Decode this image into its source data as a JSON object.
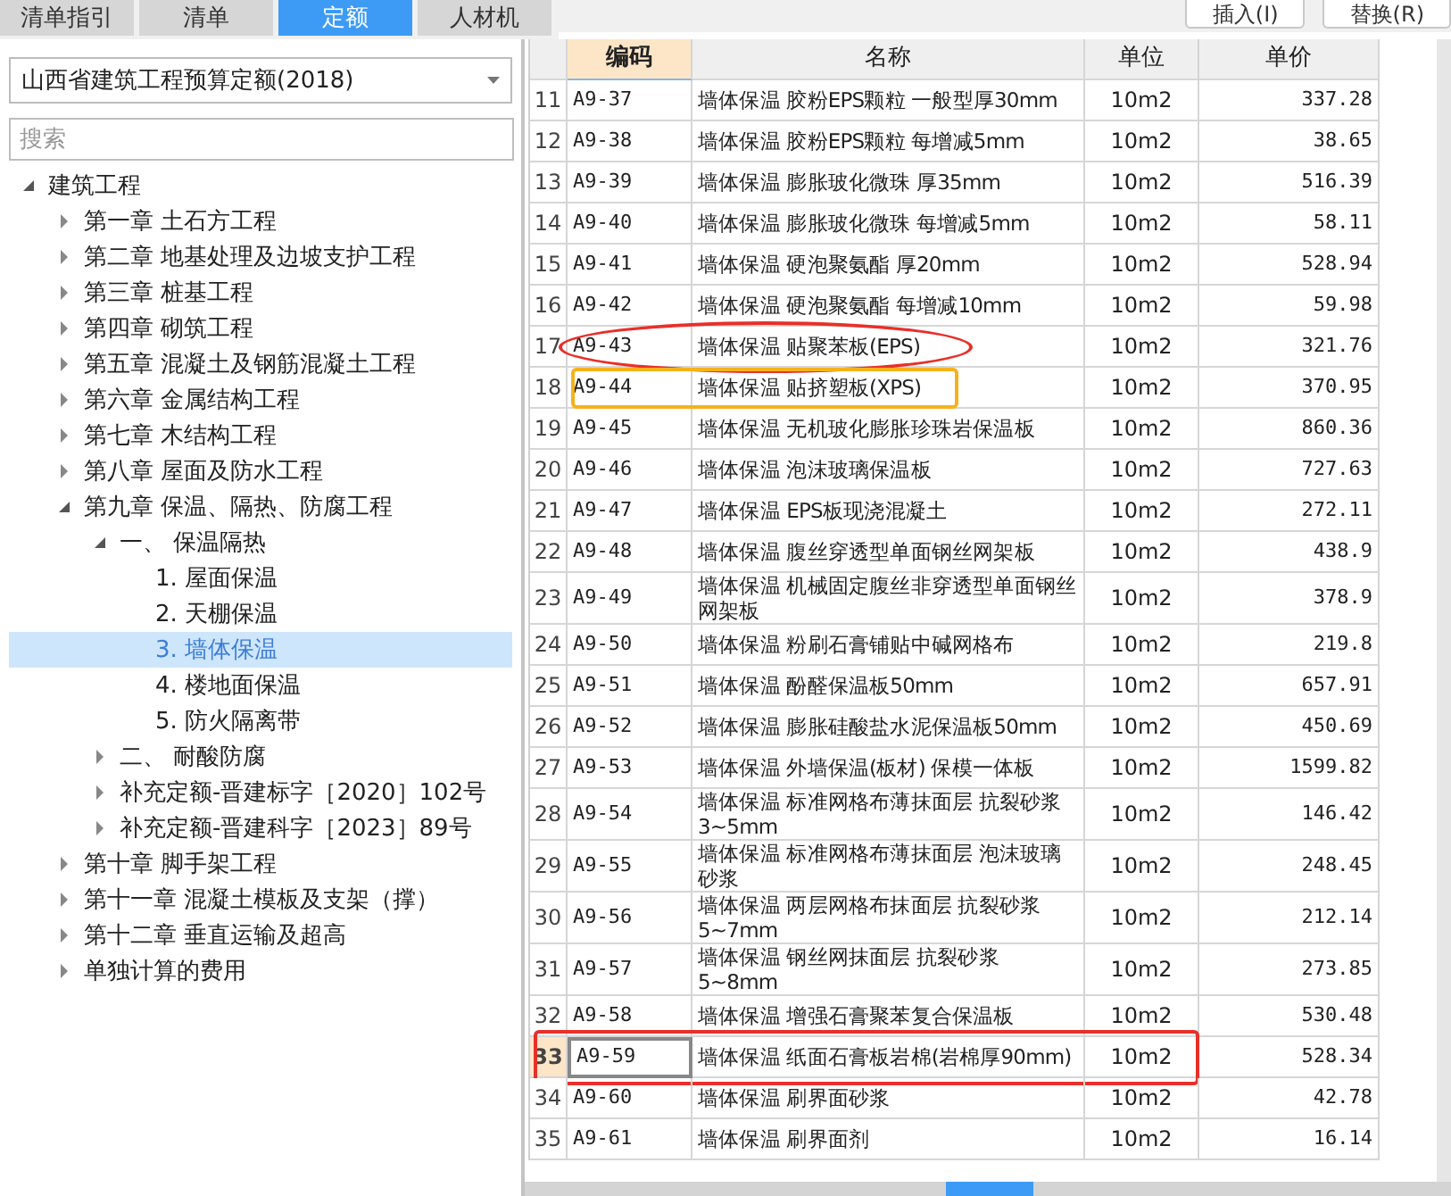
{
  "tabs": [
    {
      "label": "清单指引",
      "selected": false
    },
    {
      "label": "清单",
      "selected": false
    },
    {
      "label": "定额",
      "selected": true
    },
    {
      "label": "人材机",
      "selected": false
    }
  ],
  "toolbar": {
    "buttons": [
      "插入(I)",
      "替换(R)"
    ]
  },
  "library_select": {
    "value": "山西省建筑工程预算定额(2018)"
  },
  "search": {
    "placeholder": "搜索"
  },
  "tree": [
    {
      "label": "建筑工程",
      "expanded": true,
      "selected": false,
      "children": [
        {
          "label": "第一章 土石方工程",
          "expanded": false,
          "selected": false
        },
        {
          "label": "第二章 地基处理及边坡支护工程",
          "expanded": false,
          "selected": false
        },
        {
          "label": "第三章 桩基工程",
          "expanded": false,
          "selected": false
        },
        {
          "label": "第四章 砌筑工程",
          "expanded": false,
          "selected": false
        },
        {
          "label": "第五章 混凝土及钢筋混凝土工程",
          "expanded": false,
          "selected": false
        },
        {
          "label": "第六章 金属结构工程",
          "expanded": false,
          "selected": false
        },
        {
          "label": "第七章 木结构工程",
          "expanded": false,
          "selected": false
        },
        {
          "label": "第八章 屋面及防水工程",
          "expanded": false,
          "selected": false
        },
        {
          "label": "第九章 保温、隔热、防腐工程",
          "expanded": true,
          "selected": false,
          "children": [
            {
              "label": "一、 保温隔热",
              "expanded": true,
              "selected": false,
              "children": [
                {
                  "label": "1. 屋面保温",
                  "selected": false
                },
                {
                  "label": "2. 天棚保温",
                  "selected": false
                },
                {
                  "label": "3. 墙体保温",
                  "selected": true
                },
                {
                  "label": "4. 楼地面保温",
                  "selected": false
                },
                {
                  "label": "5. 防火隔离带",
                  "selected": false
                }
              ]
            },
            {
              "label": "二、 耐酸防腐",
              "expanded": false,
              "selected": false
            },
            {
              "label": "补充定额-晋建标字［2020］102号",
              "expanded": false,
              "selected": false
            },
            {
              "label": "补充定额-晋建科字［2023］89号",
              "expanded": false,
              "selected": false
            }
          ]
        },
        {
          "label": "第十章 脚手架工程",
          "expanded": false,
          "selected": false
        },
        {
          "label": "第十一章 混凝土模板及支架（撑）",
          "expanded": false,
          "selected": false
        },
        {
          "label": "第十二章 垂直运输及超高",
          "expanded": false,
          "selected": false
        },
        {
          "label": "单独计算的费用",
          "expanded": false,
          "selected": false
        }
      ]
    }
  ],
  "table": {
    "columns": [
      "编码",
      "名称",
      "单位",
      "单价"
    ],
    "rows": [
      {
        "no": "11",
        "code": "A9-37",
        "name": "墙体保温 胶粉EPS颗粒 一般型厚30mm",
        "unit": "10m2",
        "price": "337.28",
        "selected": false
      },
      {
        "no": "12",
        "code": "A9-38",
        "name": "墙体保温 胶粉EPS颗粒 每增减5mm",
        "unit": "10m2",
        "price": "38.65",
        "selected": false
      },
      {
        "no": "13",
        "code": "A9-39",
        "name": "墙体保温 膨胀玻化微珠 厚35mm",
        "unit": "10m2",
        "price": "516.39",
        "selected": false
      },
      {
        "no": "14",
        "code": "A9-40",
        "name": "墙体保温 膨胀玻化微珠 每增减5mm",
        "unit": "10m2",
        "price": "58.11",
        "selected": false
      },
      {
        "no": "15",
        "code": "A9-41",
        "name": "墙体保温 硬泡聚氨酯 厚20mm",
        "unit": "10m2",
        "price": "528.94",
        "selected": false
      },
      {
        "no": "16",
        "code": "A9-42",
        "name": "墙体保温 硬泡聚氨酯 每增减10mm",
        "unit": "10m2",
        "price": "59.98",
        "selected": false
      },
      {
        "no": "17",
        "code": "A9-43",
        "name": "墙体保温 贴聚苯板(EPS)",
        "unit": "10m2",
        "price": "321.76",
        "selected": false,
        "annotation": {
          "kind": "ellipse",
          "color": "#e8302a"
        }
      },
      {
        "no": "18",
        "code": "A9-44",
        "name": "墙体保温 贴挤塑板(XPS)",
        "unit": "10m2",
        "price": "370.95",
        "selected": false,
        "annotation": {
          "kind": "cellbox",
          "color": "#f5b21b"
        }
      },
      {
        "no": "19",
        "code": "A9-45",
        "name": "墙体保温 无机玻化膨胀珍珠岩保温板",
        "unit": "10m2",
        "price": "860.36",
        "selected": false
      },
      {
        "no": "20",
        "code": "A9-46",
        "name": "墙体保温 泡沫玻璃保温板",
        "unit": "10m2",
        "price": "727.63",
        "selected": false
      },
      {
        "no": "21",
        "code": "A9-47",
        "name": "墙体保温 EPS板现浇混凝土",
        "unit": "10m2",
        "price": "272.11",
        "selected": false
      },
      {
        "no": "22",
        "code": "A9-48",
        "name": "墙体保温 腹丝穿透型单面钢丝网架板",
        "unit": "10m2",
        "price": "438.9",
        "selected": false
      },
      {
        "no": "23",
        "code": "A9-49",
        "name": "墙体保温 机械固定腹丝非穿透型单面钢丝网架板",
        "unit": "10m2",
        "price": "378.9",
        "selected": false
      },
      {
        "no": "24",
        "code": "A9-50",
        "name": "墙体保温 粉刷石膏铺贴中碱网格布",
        "unit": "10m2",
        "price": "219.8",
        "selected": false
      },
      {
        "no": "25",
        "code": "A9-51",
        "name": "墙体保温 酚醛保温板50mm",
        "unit": "10m2",
        "price": "657.91",
        "selected": false
      },
      {
        "no": "26",
        "code": "A9-52",
        "name": "墙体保温 膨胀硅酸盐水泥保温板50mm",
        "unit": "10m2",
        "price": "450.69",
        "selected": false
      },
      {
        "no": "27",
        "code": "A9-53",
        "name": "墙体保温 外墙保温(板材) 保模一体板",
        "unit": "10m2",
        "price": "1599.82",
        "selected": false
      },
      {
        "no": "28",
        "code": "A9-54",
        "name": "墙体保温 标准网格布薄抹面层 抗裂砂浆3~5mm",
        "unit": "10m2",
        "price": "146.42",
        "selected": false
      },
      {
        "no": "29",
        "code": "A9-55",
        "name": "墙体保温 标准网格布薄抹面层 泡沫玻璃砂浆",
        "unit": "10m2",
        "price": "248.45",
        "selected": false
      },
      {
        "no": "30",
        "code": "A9-56",
        "name": "墙体保温 两层网格布抹面层 抗裂砂浆5~7mm",
        "unit": "10m2",
        "price": "212.14",
        "selected": false
      },
      {
        "no": "31",
        "code": "A9-57",
        "name": "墙体保温 钢丝网抹面层 抗裂砂浆5~8mm",
        "unit": "10m2",
        "price": "273.85",
        "selected": false
      },
      {
        "no": "32",
        "code": "A9-58",
        "name": "墙体保温 增强石膏聚苯复合保温板",
        "unit": "10m2",
        "price": "530.48",
        "selected": false
      },
      {
        "no": "33",
        "code": "A9-59",
        "name": "墙体保温 纸面石膏板岩棉(岩棉厚90mm)",
        "unit": "10m2",
        "price": "528.34",
        "selected": true,
        "annotation": {
          "kind": "rowbox",
          "color": "#e8302a"
        }
      },
      {
        "no": "34",
        "code": "A9-60",
        "name": "墙体保温 刷界面砂浆",
        "unit": "10m2",
        "price": "42.78",
        "selected": false
      },
      {
        "no": "35",
        "code": "A9-61",
        "name": "墙体保温 刷界面剂",
        "unit": "10m2",
        "price": "16.14",
        "selected": false
      }
    ]
  }
}
